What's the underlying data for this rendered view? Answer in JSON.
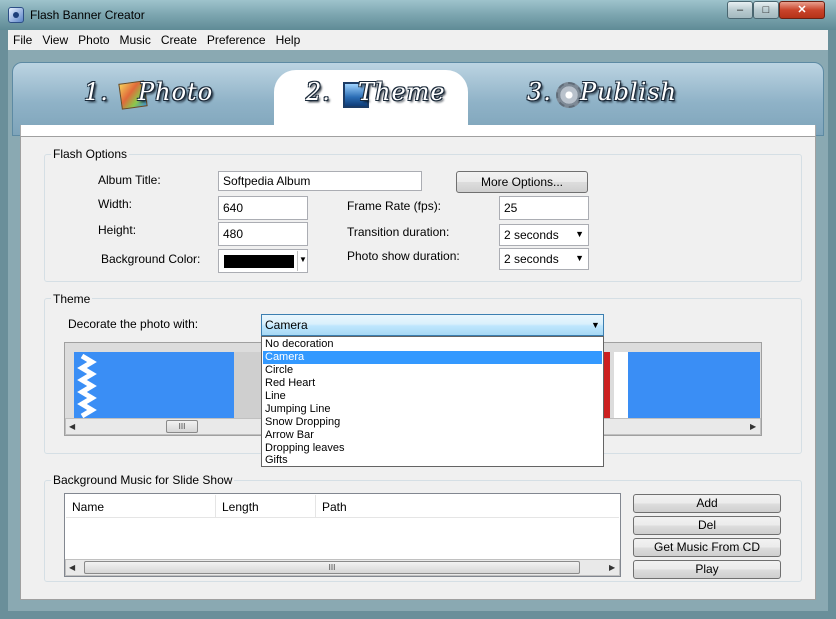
{
  "window": {
    "title": "Flash Banner Creator",
    "min_glyph": "–",
    "max_glyph": "□",
    "close_glyph": "✕"
  },
  "menu": {
    "items": [
      "File",
      "View",
      "Photo",
      "Music",
      "Create",
      "Preference",
      "Help"
    ]
  },
  "tabs": [
    {
      "number": "1.",
      "label": "Photo",
      "icon": "photo-icon",
      "active": false
    },
    {
      "number": "2.",
      "label": "Theme",
      "icon": "theme-icon",
      "active": true
    },
    {
      "number": "3.",
      "label": "Publish",
      "icon": "gear-icon",
      "active": false
    }
  ],
  "flash_options": {
    "group_label": "Flash Options",
    "album_title_label": "Album Title:",
    "album_title_value": "Softpedia Album",
    "more_options_label": "More Options...",
    "width_label": "Width:",
    "width_value": "640",
    "height_label": "Height:",
    "height_value": "480",
    "background_color_label": "Background Color:",
    "background_color_value": "#000000",
    "frame_rate_label": "Frame Rate (fps):",
    "frame_rate_value": "25",
    "transition_label": "Transition duration:",
    "transition_value": "2 seconds",
    "photo_show_label": "Photo show duration:",
    "photo_show_value": "2 seconds"
  },
  "theme": {
    "group_label": "Theme",
    "decorate_label": "Decorate the photo with:",
    "decorate_value": "Camera",
    "options": [
      "No decoration",
      "Camera",
      "Circle",
      "Red Heart",
      "Line",
      "Jumping Line",
      "Snow Dropping",
      "Arrow Bar",
      "Dropping leaves",
      "Gifts"
    ],
    "selected_index": 1,
    "scroll_thumb_glyph": "III",
    "left_arrow": "◀",
    "right_arrow": "▶"
  },
  "music": {
    "group_label": "Background Music for Slide Show",
    "columns": [
      "Name",
      "Length",
      "Path"
    ],
    "buttons": {
      "add": "Add",
      "del": "Del",
      "cd": "Get Music From CD",
      "play": "Play"
    },
    "scroll_thumb_glyph": "III"
  },
  "colors": {
    "selection": "#3399ff",
    "thumbnail_blue": "#3a8ef5",
    "accent_red": "#cc2020"
  }
}
